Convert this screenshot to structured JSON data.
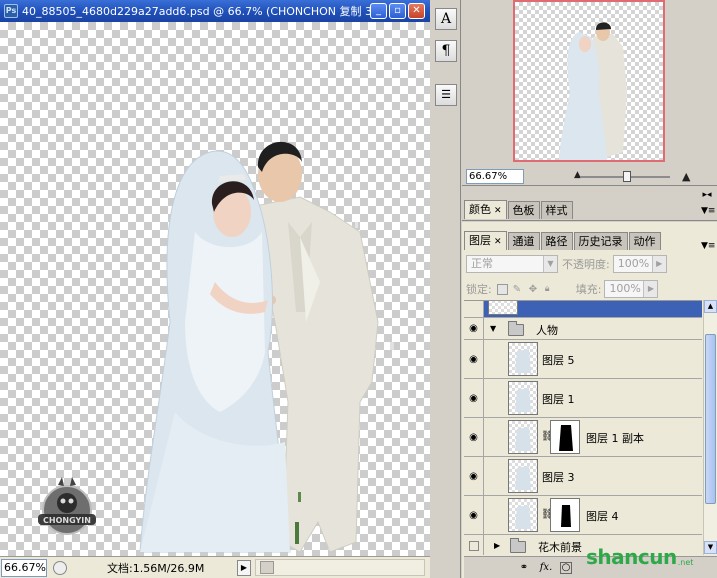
{
  "document": {
    "title": "40_88505_4680d229a27add6.psd @ 66.7% (CHONCHON 复制 3, ...",
    "app_icon": "Ps",
    "status": {
      "zoom": "66.67%",
      "doc_info": "文档:1.56M/26.9M"
    },
    "logo_text": "CHONGYIN"
  },
  "window_buttons": {
    "minimize": "_",
    "restore": "▫",
    "close": "✕"
  },
  "toolstrip": [
    {
      "icon": "character-icon",
      "glyph": "A"
    },
    {
      "icon": "paragraph-icon",
      "glyph": "¶"
    },
    {
      "icon": "notes-icon",
      "glyph": "☰"
    }
  ],
  "navigator": {
    "zoom": "66.67%"
  },
  "color_panel": {
    "tabs": [
      {
        "label": "颜色",
        "active": true
      },
      {
        "label": "色板",
        "active": false
      },
      {
        "label": "样式",
        "active": false
      }
    ]
  },
  "layers_panel": {
    "tabs": [
      {
        "label": "图层",
        "active": true
      },
      {
        "label": "通道",
        "active": false
      },
      {
        "label": "路径",
        "active": false
      },
      {
        "label": "历史记录",
        "active": false
      },
      {
        "label": "动作",
        "active": false
      }
    ],
    "blend_mode": "正常",
    "opacity_label": "不透明度:",
    "opacity_value": "100%",
    "lock_label": "锁定:",
    "fill_label": "填充:",
    "fill_value": "100%",
    "layers": [
      {
        "name": "",
        "type": "layer",
        "selected": true,
        "visible": false,
        "partial": true
      },
      {
        "name": "人物",
        "type": "group",
        "visible": true,
        "expanded": true
      },
      {
        "name": "图层 5",
        "type": "layer",
        "visible": true
      },
      {
        "name": "图层 1",
        "type": "layer",
        "visible": true
      },
      {
        "name": "图层 1 副本",
        "type": "layer-mask",
        "visible": true
      },
      {
        "name": "图层 3",
        "type": "layer",
        "visible": true
      },
      {
        "name": "图层 4",
        "type": "layer-mask",
        "visible": true
      },
      {
        "name": "花木前景",
        "type": "group",
        "visible": false,
        "expanded": false
      }
    ],
    "footer_icons": [
      "link-icon",
      "fx-icon",
      "mask-icon"
    ]
  },
  "watermark": {
    "main": "shancun",
    "sub": ".net"
  }
}
